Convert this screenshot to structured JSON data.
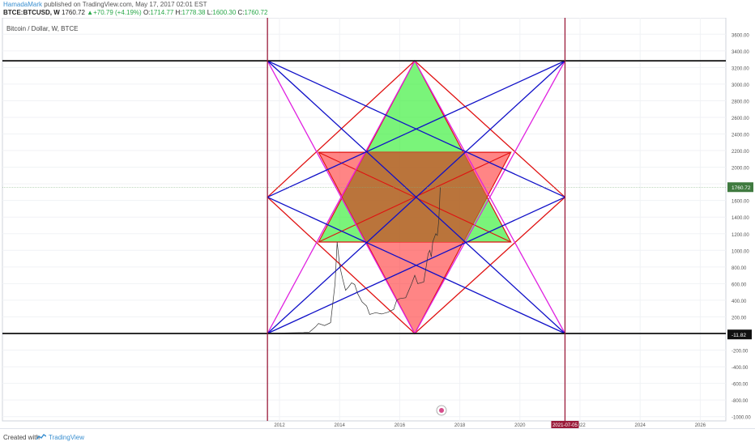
{
  "header": {
    "author": "HamadaMark",
    "published": "published on TradingView.com, May 17, 2017 02:01 EST",
    "symbol": "BTCE:BTCUSD, W",
    "last": "1760.72",
    "change": "+70.79 (+4.19%)",
    "ohlc": [
      {
        "label": "O:",
        "value": "1714.77"
      },
      {
        "label": "H:",
        "value": "1778.38"
      },
      {
        "label": "L:",
        "value": "1600.30"
      },
      {
        "label": "C:",
        "value": "1760.72"
      }
    ]
  },
  "footer": {
    "created_with": "Created with",
    "brand": "TradingView"
  },
  "colors": {
    "red": "#e01010",
    "blue": "#1010c8",
    "magenta": "#e020e0",
    "green": "#33ee33",
    "salmon": "#ff3333",
    "overlap": "#b8733a",
    "maroon": "#9a1b3a",
    "price_tag": "#3f7a3f"
  },
  "chart_data": {
    "type": "line",
    "title": "Bitcoin / Dollar, W, BTCE",
    "x_ticks": [
      "2012",
      "2014",
      "2016",
      "2018",
      "2020",
      "2022",
      "2024",
      "2026"
    ],
    "y_ticks": [
      "3600.00",
      "3400.00",
      "3200.00",
      "3000.00",
      "2800.00",
      "2600.00",
      "2400.00",
      "2200.00",
      "2000.00",
      "1800.00",
      "1600.00",
      "1400.00",
      "1200.00",
      "1000.00",
      "800.00",
      "600.00",
      "400.00",
      "200.00",
      "0.00",
      "-200.00",
      "-400.00",
      "-600.00",
      "-800.00",
      "-1000.00"
    ],
    "ylim": [
      -1000,
      3600
    ],
    "current_price_label": "1760.72",
    "cursor_price_label": "-11.82",
    "date_label": "2021-07-05",
    "price_series": [
      [
        2011.5,
        2
      ],
      [
        2012.0,
        5
      ],
      [
        2012.5,
        9
      ],
      [
        2012.8,
        12
      ],
      [
        2013.0,
        18
      ],
      [
        2013.2,
        80
      ],
      [
        2013.3,
        120
      ],
      [
        2013.5,
        95
      ],
      [
        2013.7,
        130
      ],
      [
        2013.85,
        600
      ],
      [
        2013.92,
        1100
      ],
      [
        2014.0,
        820
      ],
      [
        2014.1,
        660
      ],
      [
        2014.2,
        520
      ],
      [
        2014.3,
        560
      ],
      [
        2014.4,
        610
      ],
      [
        2014.5,
        590
      ],
      [
        2014.6,
        480
      ],
      [
        2014.75,
        380
      ],
      [
        2014.9,
        330
      ],
      [
        2015.0,
        230
      ],
      [
        2015.2,
        250
      ],
      [
        2015.4,
        235
      ],
      [
        2015.6,
        255
      ],
      [
        2015.8,
        290
      ],
      [
        2015.9,
        400
      ],
      [
        2016.0,
        420
      ],
      [
        2016.2,
        430
      ],
      [
        2016.4,
        600
      ],
      [
        2016.5,
        700
      ],
      [
        2016.6,
        600
      ],
      [
        2016.8,
        620
      ],
      [
        2016.95,
        960
      ],
      [
        2017.0,
        1000
      ],
      [
        2017.05,
        920
      ],
      [
        2017.1,
        1100
      ],
      [
        2017.2,
        1200
      ],
      [
        2017.25,
        1180
      ],
      [
        2017.3,
        1350
      ],
      [
        2017.35,
        1760
      ]
    ],
    "horizontal_lines": [
      3280,
      0
    ],
    "vertical_lines": [
      2011.6,
      2021.5
    ],
    "shapes": {
      "green_triangle": [
        [
          2016.5,
          3280
        ],
        [
          2013.3,
          1100
        ],
        [
          2019.7,
          1100
        ]
      ],
      "red_triangle": [
        [
          2016.5,
          0
        ],
        [
          2013.3,
          2180
        ],
        [
          2019.7,
          2180
        ]
      ],
      "red_diamond": [
        [
          2016.5,
          3280
        ],
        [
          2021.5,
          1640
        ],
        [
          2016.5,
          0
        ],
        [
          2011.6,
          1640
        ]
      ],
      "magenta_lines": [
        [
          [
            2011.6,
            3280
          ],
          [
            2016.5,
            0
          ]
        ],
        [
          [
            2016.5,
            0
          ],
          [
            2021.5,
            3280
          ]
        ],
        [
          [
            2011.6,
            0
          ],
          [
            2016.5,
            3280
          ]
        ],
        [
          [
            2016.5,
            3280
          ],
          [
            2021.5,
            0
          ]
        ]
      ],
      "blue_lines": [
        [
          [
            2011.6,
            3280
          ],
          [
            2021.5,
            1640
          ]
        ],
        [
          [
            2011.6,
            3280
          ],
          [
            2021.5,
            0
          ]
        ],
        [
          [
            2021.5,
            3280
          ],
          [
            2011.6,
            1640
          ]
        ],
        [
          [
            2021.5,
            3280
          ],
          [
            2011.6,
            0
          ]
        ],
        [
          [
            2011.6,
            0
          ],
          [
            2021.5,
            1640
          ]
        ],
        [
          [
            2021.5,
            0
          ],
          [
            2011.6,
            1640
          ]
        ]
      ]
    }
  }
}
